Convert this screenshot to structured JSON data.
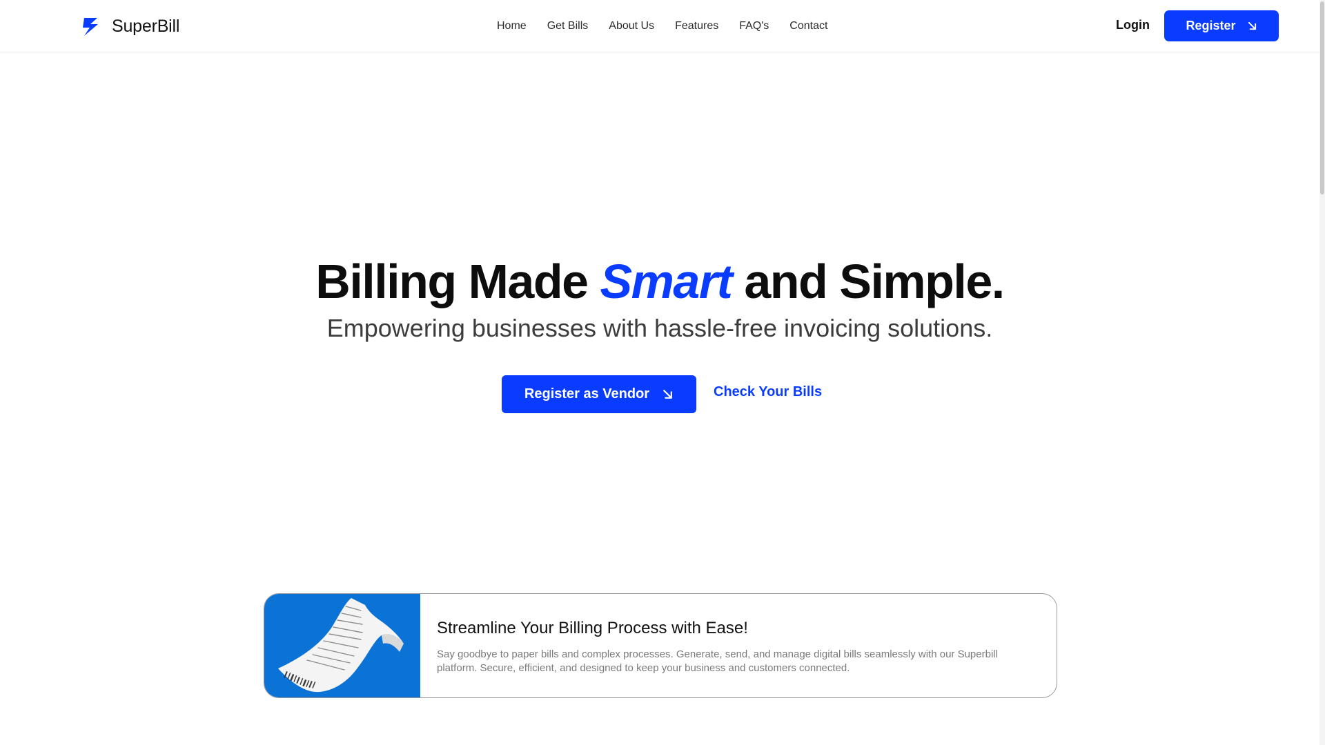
{
  "brand": {
    "name": "SuperBill",
    "accent_color": "#0a3cff",
    "logo_icon": "lightning-bolt-icon"
  },
  "nav": {
    "items": [
      {
        "label": "Home"
      },
      {
        "label": "Get Bills"
      },
      {
        "label": "About Us"
      },
      {
        "label": "Features"
      },
      {
        "label": "FAQ's"
      },
      {
        "label": "Contact"
      }
    ],
    "login_label": "Login",
    "register_label": "Register",
    "register_icon": "arrow-down-right-icon"
  },
  "hero": {
    "title_part1": "Billing Made ",
    "title_accent": "Smart",
    "title_part2": " and Simple.",
    "subtitle": "Empowering businesses with hassle-free invoicing solutions.",
    "primary_cta": "Register as Vendor",
    "primary_cta_icon": "arrow-down-right-icon",
    "secondary_cta": "Check Your Bills"
  },
  "feature_card": {
    "image": "receipt-illustration",
    "title": "Streamline Your Billing Process with Ease!",
    "description": "Say goodbye to paper bills and complex processes. Generate, send, and manage digital bills seamlessly with our Superbill platform. Secure, efficient, and designed to keep your business and customers connected."
  }
}
